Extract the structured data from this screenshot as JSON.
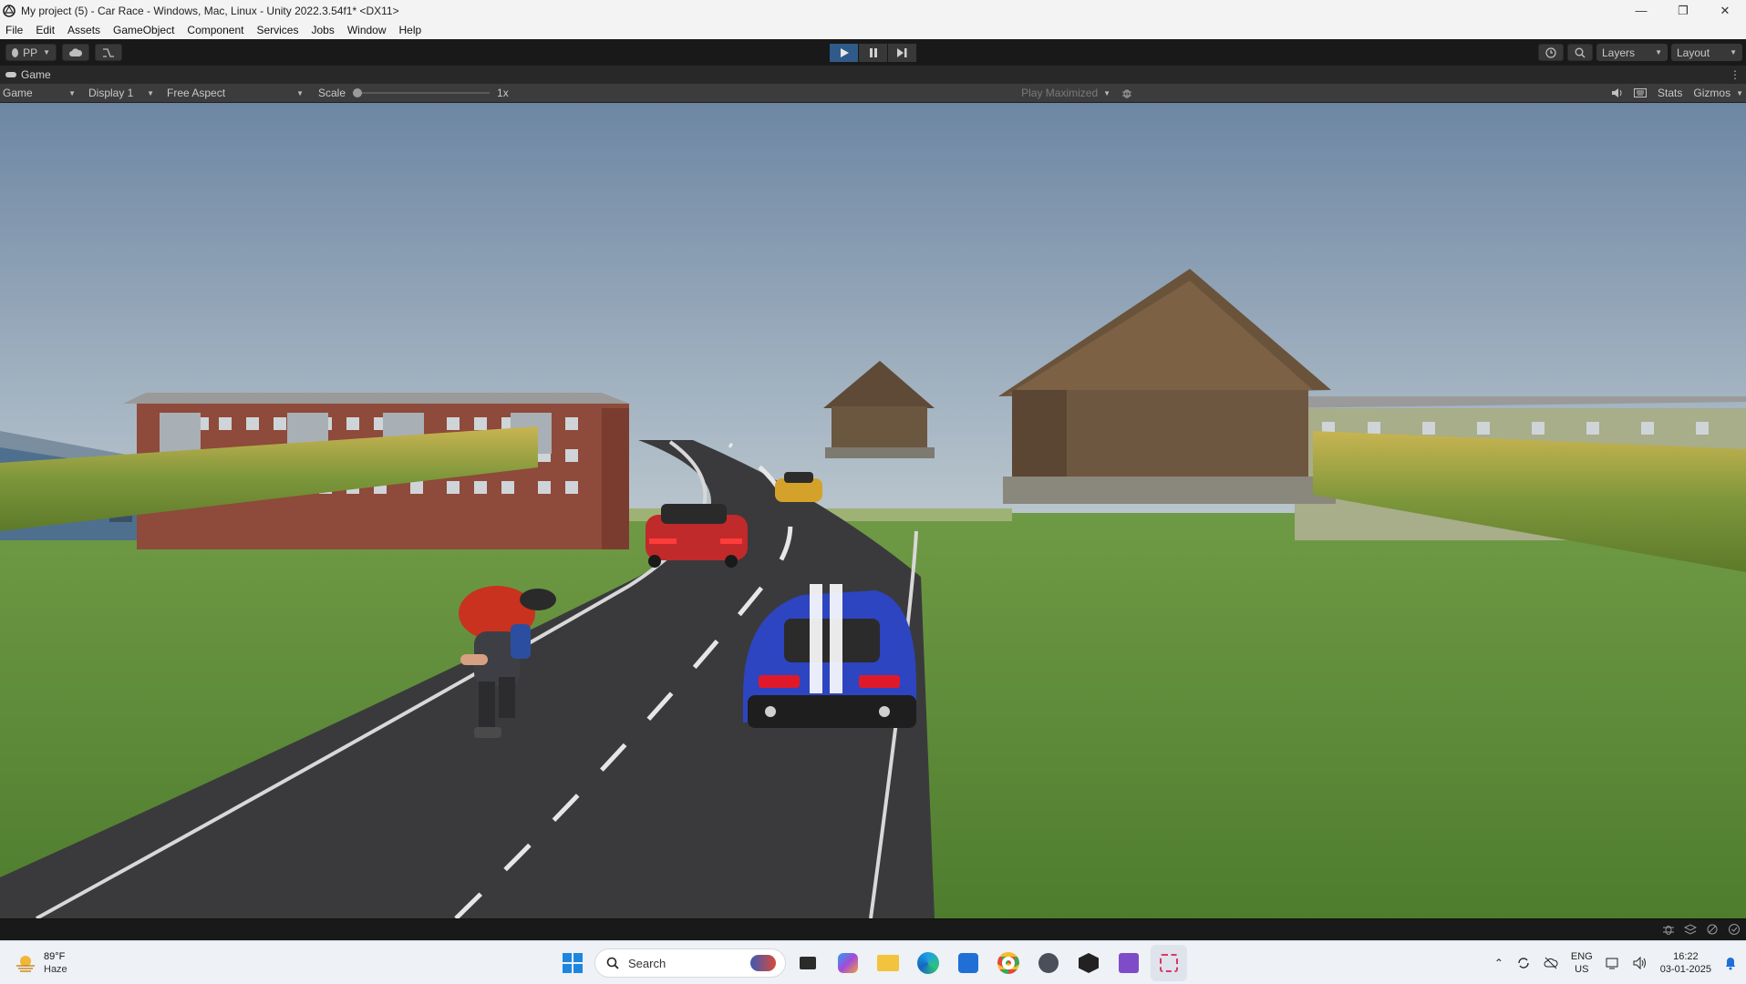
{
  "window": {
    "title": "My project (5) - Car Race - Windows, Mac, Linux - Unity 2022.3.54f1* <DX11>",
    "minimize": "—",
    "maximize": "❐",
    "close": "✕"
  },
  "menu": [
    "File",
    "Edit",
    "Assets",
    "GameObject",
    "Component",
    "Services",
    "Jobs",
    "Window",
    "Help"
  ],
  "toolbar": {
    "account_label": "PP",
    "layers_label": "Layers",
    "layout_label": "Layout"
  },
  "game_view": {
    "tab_label": "Game",
    "mode_label": "Game",
    "display_label": "Display 1",
    "aspect_label": "Free Aspect",
    "scale_label": "Scale",
    "scale_value": "1x",
    "play_mode_label": "Play Maximized",
    "stats_label": "Stats",
    "gizmos_label": "Gizmos"
  },
  "taskbar": {
    "weather_temp": "89°F",
    "weather_desc": "Haze",
    "search_placeholder": "Search",
    "lang_top": "ENG",
    "lang_bottom": "US",
    "time": "16:22",
    "date": "03-01-2025"
  },
  "colors": {
    "play_active": "#2f5a8a",
    "sky_top": "#6d86a3",
    "grass": "#5d8c3a",
    "road": "#3a3a3c"
  }
}
